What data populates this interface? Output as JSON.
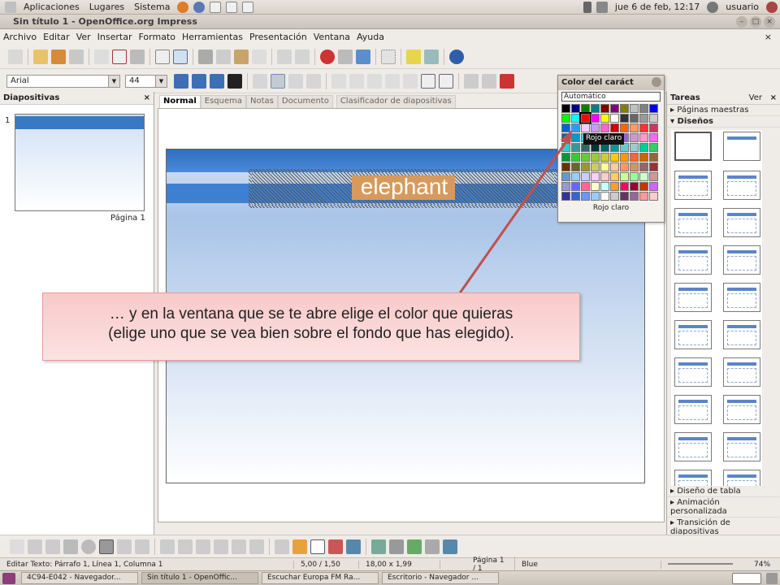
{
  "topbar": {
    "apps": "Aplicaciones",
    "places": "Lugares",
    "system": "Sistema",
    "clock": "jue  6 de feb, 12:17",
    "user": "usuario"
  },
  "window": {
    "title": "Sin título 1 - OpenOffice.org Impress"
  },
  "menu": [
    "Archivo",
    "Editar",
    "Ver",
    "Insertar",
    "Formato",
    "Herramientas",
    "Presentación",
    "Ventana",
    "Ayuda"
  ],
  "format": {
    "font": "Arial",
    "size": "44"
  },
  "left_panel": {
    "title": "Diapositivas",
    "slide_number": "1",
    "page_label": "Página 1"
  },
  "tabs": [
    "Normal",
    "Esquema",
    "Notas",
    "Documento",
    "Clasificador de diapositivas"
  ],
  "slide": {
    "text": "elephant"
  },
  "palette": {
    "title": "Color del caráct",
    "automatic": "Automático",
    "footer": "Rojo claro",
    "tooltip": "Rojo claro",
    "colors": [
      "#000000",
      "#000080",
      "#008000",
      "#008080",
      "#800000",
      "#800080",
      "#808000",
      "#c0c0c0",
      "#808080",
      "#0000ff",
      "#00ff00",
      "#00ffff",
      "#ff0000",
      "#ff00ff",
      "#ffff00",
      "#ffffff",
      "#333333",
      "#666666",
      "#999999",
      "#cccccc",
      "#0066cc",
      "#3399ff",
      "#ffccff",
      "#cc99ff",
      "#ff66cc",
      "#cc0000",
      "#ff6600",
      "#ff9966",
      "#ff3333",
      "#cc3366",
      "#006699",
      "#0099cc",
      "#33ccff",
      "#9999ff",
      "#6666cc",
      "#663399",
      "#9966cc",
      "#cc99cc",
      "#ff99cc",
      "#ff66ff",
      "#33cccc",
      "#339999",
      "#336666",
      "#003333",
      "#006666",
      "#009999",
      "#66cccc",
      "#99cccc",
      "#00cc99",
      "#33cc66",
      "#009933",
      "#33cc33",
      "#66cc33",
      "#99cc33",
      "#cccc33",
      "#ffcc00",
      "#ff9900",
      "#ff6633",
      "#cc6600",
      "#996633",
      "#663300",
      "#666633",
      "#999933",
      "#cccc66",
      "#ffff99",
      "#ffcc99",
      "#ff9966",
      "#cc9966",
      "#996666",
      "#993333",
      "#6699cc",
      "#99ccff",
      "#ccccff",
      "#ffccff",
      "#ffcccc",
      "#ffcc66",
      "#ccff99",
      "#99ff99",
      "#ccffcc",
      "#cc9999",
      "#9999cc",
      "#6666ff",
      "#ff6699",
      "#ffffcc",
      "#ccffff",
      "#ff9933",
      "#ff0066",
      "#990033",
      "#cc3300",
      "#cc66ff",
      "#333399",
      "#3366cc",
      "#6699ff",
      "#99ccff",
      "#ffffff",
      "#cccccc",
      "#663366",
      "#996699",
      "#ff9999",
      "#ffcccc"
    ]
  },
  "caption": {
    "line1": "… y en la ventana que se te abre elige el color que quieras",
    "line2": "(elige uno que se vea bien sobre el fondo que has elegido)."
  },
  "right_panel": {
    "title": "Tareas",
    "view": "Ver",
    "sections": [
      "Páginas maestras",
      "Diseños"
    ],
    "bottom": [
      "Diseño de tabla",
      "Animación personalizada",
      "Transición de diapositivas"
    ]
  },
  "status": {
    "mode": "Editar Texto: Párrafo 1, Línea 1, Columna 1",
    "pos": "5,00 / 1,50",
    "size": "18,00 x 1,99",
    "page": "Página 1 / 1",
    "master": "Blue",
    "zoom": "74%"
  },
  "taskbar": [
    "4C94-E042 - Navegador...",
    "Sin título 1 - OpenOffic...",
    "Escuchar Europa FM Ra...",
    "Escritorio - Navegador ..."
  ]
}
